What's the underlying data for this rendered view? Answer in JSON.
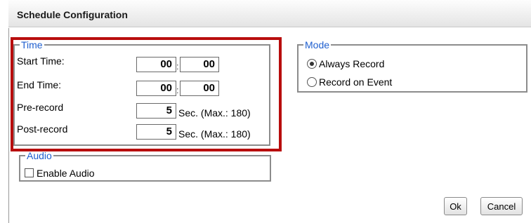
{
  "dialog": {
    "title": "Schedule Configuration"
  },
  "time": {
    "legend": "Time",
    "start_label": "Start Time:",
    "start_hour": "00",
    "start_minute": "00",
    "end_label": "End Time:",
    "end_hour": "00",
    "end_minute": "00",
    "colon": ":",
    "pre_label": "Pre-record",
    "pre_value": "5",
    "pre_unit": "Sec. (Max.: 180)",
    "post_label": "Post-record",
    "post_value": "5",
    "post_unit": "Sec. (Max.: 180)"
  },
  "audio": {
    "legend": "Audio",
    "enable_label": "Enable Audio",
    "enabled": false
  },
  "mode": {
    "legend": "Mode",
    "options": [
      {
        "label": "Always Record",
        "selected": true
      },
      {
        "label": "Record on Event",
        "selected": false
      }
    ]
  },
  "buttons": {
    "ok": "Ok",
    "cancel": "Cancel"
  },
  "colors": {
    "highlight_border": "#b80d0d",
    "legend_text": "#1f5fcf"
  }
}
